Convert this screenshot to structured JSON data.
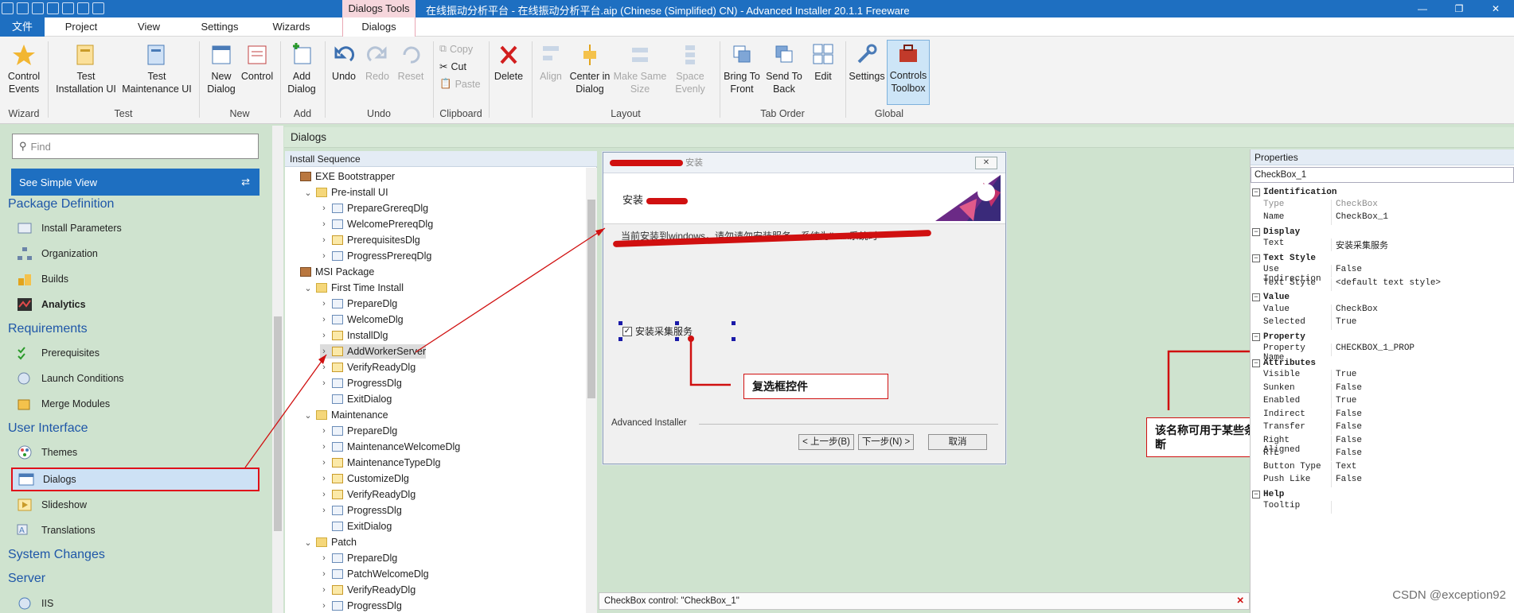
{
  "window": {
    "context_tab": "Dialogs Tools",
    "title": "在线振动分析平台 - 在线振动分析平台.aip (Chinese (Simplified) CN) - Advanced Installer 20.1.1 Freeware",
    "controls": [
      "—",
      "❐",
      "✕"
    ]
  },
  "tabs": [
    "文件",
    "Project",
    "View",
    "Settings",
    "Wizards",
    "Dialogs"
  ],
  "ribbon": {
    "buttons": [
      {
        "label": "Control\nEvents",
        "icon": "wizard-icon"
      },
      {
        "label": "Test\nInstallation UI",
        "icon": "test-install-icon"
      },
      {
        "label": "Test\nMaintenance UI",
        "icon": "test-maint-icon"
      },
      {
        "label": "New\nDialog",
        "icon": "new-dialog-icon"
      },
      {
        "label": "Control",
        "icon": "control-icon"
      },
      {
        "label": "Add\nDialog",
        "icon": "add-dialog-icon"
      },
      {
        "label": "Undo",
        "icon": "undo-icon"
      },
      {
        "label": "Redo",
        "icon": "redo-icon"
      },
      {
        "label": "Reset",
        "icon": "reset-icon"
      },
      {
        "label": "Delete",
        "icon": "delete-icon"
      },
      {
        "label": "Align",
        "icon": "align-icon"
      },
      {
        "label": "Center in\nDialog",
        "icon": "center-icon"
      },
      {
        "label": "Make Same\nSize",
        "icon": "same-size-icon"
      },
      {
        "label": "Space\nEvenly",
        "icon": "space-icon"
      },
      {
        "label": "Bring To\nFront",
        "icon": "front-icon"
      },
      {
        "label": "Send To\nBack",
        "icon": "back-icon"
      },
      {
        "label": "Edit",
        "icon": "edit-order-icon"
      },
      {
        "label": "Settings",
        "icon": "settings-icon"
      },
      {
        "label": "Controls\nToolbox",
        "icon": "toolbox-icon"
      }
    ],
    "clipboard": [
      "Copy",
      "Cut",
      "Paste"
    ],
    "groups": [
      "Wizard",
      "Test",
      "New",
      "Add",
      "Undo",
      "Clipboard",
      "Layout",
      "Tab Order",
      "Global"
    ]
  },
  "left": {
    "find_placeholder": "Find",
    "simple_view": "See Simple View",
    "sections": [
      "Package Definition",
      "Requirements",
      "User Interface",
      "System Changes",
      "Server"
    ],
    "items": [
      "Install Parameters",
      "Organization",
      "Builds",
      "Analytics",
      "Prerequisites",
      "Launch Conditions",
      "Merge Modules",
      "Themes",
      "Dialogs",
      "Slideshow",
      "Translations",
      "IIS"
    ]
  },
  "main": {
    "heading": "Dialogs",
    "tree_header": "Install Sequence",
    "tree": [
      "EXE Bootstrapper",
      "Pre-install UI",
      "PrepareGrereqDlg",
      "WelcomePrereqDlg",
      "PrerequisitesDlg",
      "ProgressPrereqDlg",
      "MSI Package",
      "First Time Install",
      "PrepareDlg",
      "WelcomeDlg",
      "InstallDlg",
      "AddWorkerServer",
      "VerifyReadyDlg",
      "ProgressDlg",
      "ExitDialog",
      "Maintenance",
      "PrepareDlg",
      "MaintenanceWelcomeDlg",
      "MaintenanceTypeDlg",
      "CustomizeDlg",
      "VerifyReadyDlg",
      "ProgressDlg",
      "ExitDialog",
      "Patch",
      "PrepareDlg",
      "PatchWelcomeDlg",
      "VerifyReadyDlg",
      "ProgressDlg"
    ]
  },
  "preview": {
    "title": "安装",
    "header": "安装",
    "description": "当前安装到windows，请勿请勿安装服务，系统为linux系统时",
    "checkbox": "安装采集服务",
    "footer_label": "Advanced Installer",
    "back": "< 上一步(B)",
    "next": "下一步(N) >",
    "cancel": "取消"
  },
  "callouts": {
    "checkbox": "复选框控件",
    "property": "该名称可用于某些条件判断"
  },
  "properties": {
    "header": "Properties",
    "combo": "CheckBox_1",
    "rows": [
      {
        "cat": "Identification"
      },
      {
        "k": "Type",
        "v": "CheckBox",
        "ro": true
      },
      {
        "k": "Name",
        "v": "CheckBox_1"
      },
      {
        "cat": "Display"
      },
      {
        "k": "Text",
        "v": "安装采集服务"
      },
      {
        "cat": "Text Style"
      },
      {
        "k": "Use Indirection",
        "v": "False"
      },
      {
        "k": "Text Style",
        "v": "<default text style>"
      },
      {
        "cat": "Value"
      },
      {
        "k": "Value",
        "v": "CheckBox"
      },
      {
        "k": "Selected",
        "v": "True"
      },
      {
        "cat": "Property"
      },
      {
        "k": "Property Name",
        "v": "CHECKBOX_1_PROP"
      },
      {
        "cat": "Attributes"
      },
      {
        "k": "Visible",
        "v": "True"
      },
      {
        "k": "Sunken",
        "v": "False"
      },
      {
        "k": "Enabled",
        "v": "True"
      },
      {
        "k": "Indirect",
        "v": "False"
      },
      {
        "k": "Transfer",
        "v": "False"
      },
      {
        "k": "Right Aligned",
        "v": "False"
      },
      {
        "k": "RTL",
        "v": "False"
      },
      {
        "k": "Button Type",
        "v": "Text"
      },
      {
        "k": "Push Like",
        "v": "False"
      },
      {
        "cat": "Help"
      },
      {
        "k": "Tooltip",
        "v": ""
      }
    ]
  },
  "status": "CheckBox control: \"CheckBox_1\"",
  "watermark": "CSDN @exception92",
  "colors": {
    "accent": "#1e6fc1",
    "annotation": "#d01010",
    "panel": "#cfe3cf"
  }
}
